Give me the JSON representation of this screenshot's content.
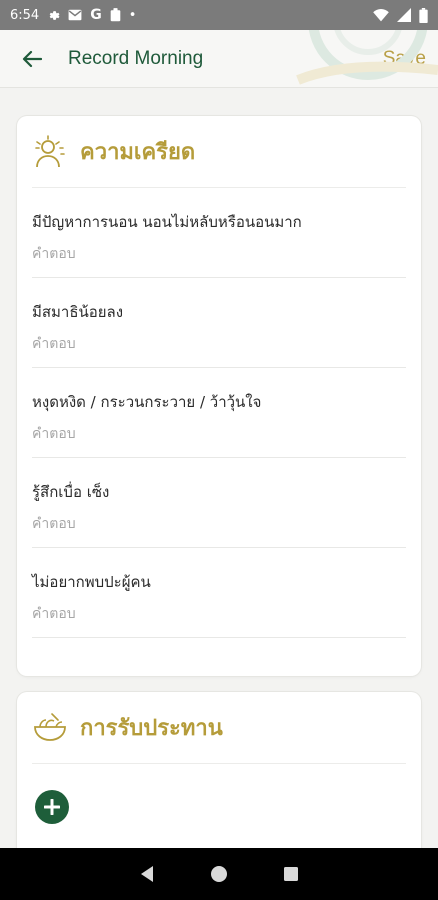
{
  "status_bar": {
    "time": "6:54",
    "g_label": "G",
    "dot": "•",
    "icons": [
      "settings-icon",
      "gmail-icon",
      "google-icon",
      "clipboard-icon",
      "wifi-icon",
      "signal-icon",
      "battery-icon"
    ]
  },
  "app_bar": {
    "title": "Record Morning",
    "save_label": "Save"
  },
  "stress_section": {
    "title": "ความเครียด",
    "icon": "person-stress-icon",
    "questions": [
      {
        "label": "มีปัญหาการนอน นอนไม่หลับหรือนอนมาก",
        "placeholder": "คำตอบ",
        "value": ""
      },
      {
        "label": "มีสมาธิน้อยลง",
        "placeholder": "คำตอบ",
        "value": ""
      },
      {
        "label": "หงุดหงิด / กระวนกระวาย / ว้าวุ้นใจ",
        "placeholder": "คำตอบ",
        "value": ""
      },
      {
        "label": "รู้สึกเบื่อ เซ็ง",
        "placeholder": "คำตอบ",
        "value": ""
      },
      {
        "label": "ไม่อยากพบปะผู้คน",
        "placeholder": "คำตอบ",
        "value": ""
      }
    ]
  },
  "food_section": {
    "title": "การรับประทาน",
    "icon": "food-bowl-icon",
    "add_icon": "add-circle-icon"
  },
  "colors": {
    "primary_green": "#1f5a3a",
    "accent_gold": "#b59c3a"
  }
}
